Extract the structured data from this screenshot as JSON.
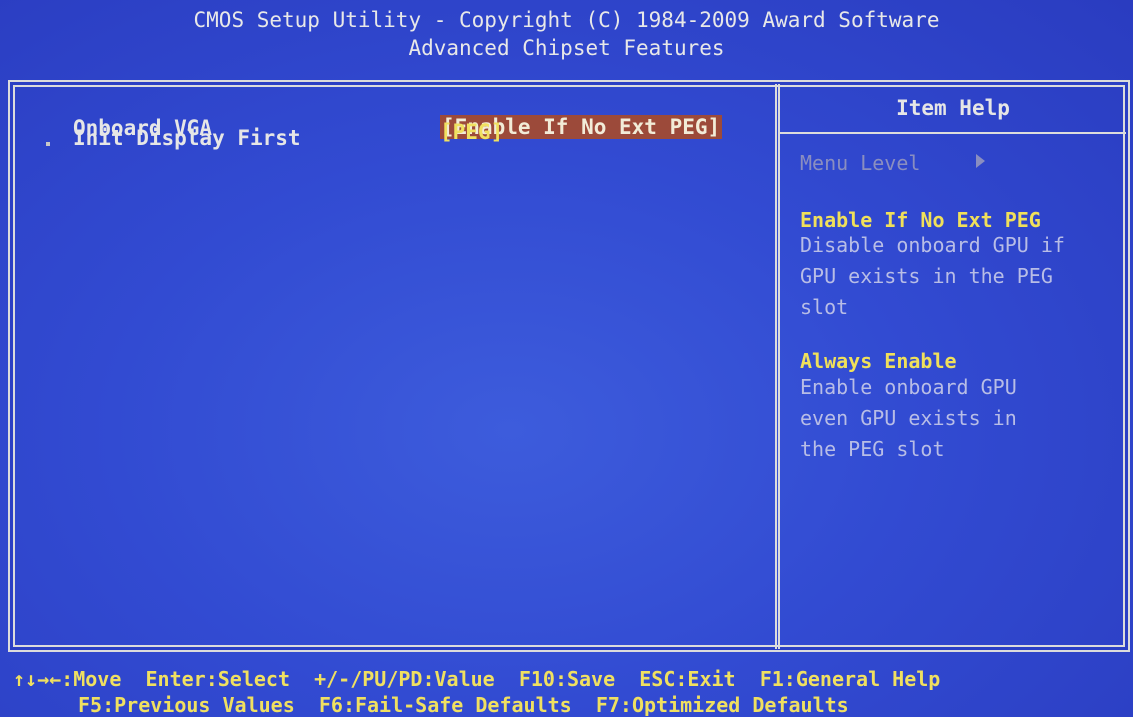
{
  "header": {
    "title": "CMOS Setup Utility - Copyright (C) 1984-2009 Award Software",
    "subtitle": "Advanced Chipset Features"
  },
  "settings": [
    {
      "label": "Onboard VGA",
      "value": "[Enable If No Ext PEG]",
      "selected": true
    },
    {
      "label": "Init Display First",
      "value": "[PEG]",
      "selected": false
    }
  ],
  "item_help": {
    "title": "Item Help",
    "menu_level": "Menu Level",
    "entries": [
      {
        "heading": "Enable If No Ext PEG",
        "body": "Disable onboard GPU if\nGPU exists in the PEG\nslot"
      },
      {
        "heading": "Always Enable",
        "body": "Enable onboard GPU\neven GPU exists in\nthe PEG slot"
      }
    ]
  },
  "footer": {
    "line1": [
      {
        "key": "↑↓→←",
        "desc": ":Move"
      },
      {
        "key": "Enter",
        "desc": ":Select"
      },
      {
        "key": "+/-/PU/PD",
        "desc": ":Value"
      },
      {
        "key": "F10",
        "desc": ":Save"
      },
      {
        "key": "ESC",
        "desc": ":Exit"
      },
      {
        "key": "F1",
        "desc": ":General Help"
      }
    ],
    "line2": [
      {
        "key": "F5",
        "desc": ":Previous Values"
      },
      {
        "key": "F6",
        "desc": ":Fail-Safe Defaults"
      },
      {
        "key": "F7",
        "desc": ":Optimized Defaults"
      }
    ]
  },
  "colors": {
    "background": "#324bd2",
    "highlight": "#9c4a3a",
    "value_text": "#f0e060",
    "frame": "#dcdcdc"
  }
}
